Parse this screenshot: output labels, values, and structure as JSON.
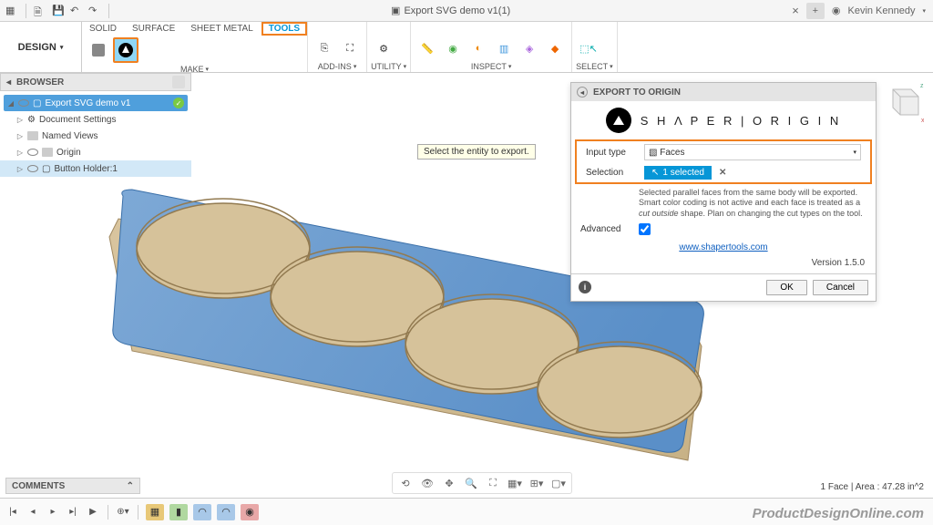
{
  "titlebar": {
    "doc_title": "Export SVG demo v1(1)",
    "user": "Kevin Kennedy"
  },
  "ribbon": {
    "design_btn": "DESIGN",
    "tabs": {
      "solid": "SOLID",
      "surface": "SURFACE",
      "sheet_metal": "SHEET METAL",
      "tools": "TOOLS"
    },
    "groups": {
      "make": "MAKE",
      "addins": "ADD-INS",
      "utility": "UTILITY",
      "inspect": "INSPECT",
      "select": "SELECT"
    }
  },
  "browser": {
    "title": "BROWSER",
    "root": "Export SVG demo v1",
    "items": [
      "Document Settings",
      "Named Views",
      "Origin",
      "Button Holder:1"
    ]
  },
  "tooltip": "Select the entity to export.",
  "panel": {
    "title": "EXPORT TO ORIGIN",
    "logo": "S H Λ P E R | O R I G I N",
    "rows": {
      "input_type_label": "Input type",
      "input_type_value": "Faces",
      "selection_label": "Selection",
      "selection_value": "1 selected",
      "advanced_label": "Advanced"
    },
    "desc": "Selected parallel faces from the same body will be exported. Smart color coding is not active and each face is treated as a cut outside shape. Plan on changing the cut types on the tool.",
    "link": "www.shapertools.com",
    "version": "Version 1.5.0",
    "ok": "OK",
    "cancel": "Cancel"
  },
  "comments": "COMMENTS",
  "status": "1 Face | Area : 47.28 in^2",
  "watermark": "ProductDesignOnline.com"
}
